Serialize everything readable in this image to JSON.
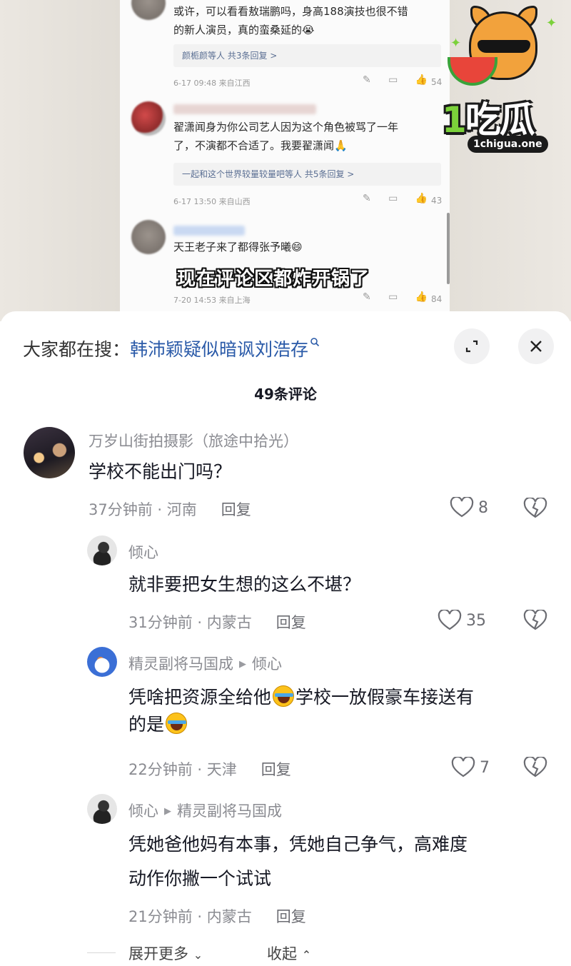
{
  "video": {
    "inner_comments": [
      {
        "text_l1": "或许，可以看看敖瑞鹏吗，身高188演技也很不错",
        "text_l2": "的新人演员，真的蛮桑延的😭",
        "replies": "颜栀颜等人  共3条回复 >",
        "meta": "6-17 09:48  来自江西",
        "likes": "54"
      },
      {
        "text_l1": "翟潇闻身为你公司艺人因为这个角色被骂了一年",
        "text_l2": "了，不演都不合适了。我要翟潇闻🙏",
        "replies": "一起和这个世界较量较量吧等人  共5条回复 >",
        "meta": "6-17 13:50  来自山西",
        "likes": "43"
      },
      {
        "text_l1": "天王老子来了都得张予曦😄",
        "meta": "7-20 14:53  来自上海",
        "likes": "84"
      }
    ],
    "caption": "现在评论区都炸开锅了"
  },
  "watermark": {
    "logo_text_num": "1",
    "logo_text": "吃瓜",
    "logo_url": "1chigua.one"
  },
  "sheet": {
    "search_prefix": "大家都在搜：",
    "search_query": "韩沛颖疑似暗讽刘浩存",
    "comment_count": "49条评论",
    "expand_icon": "expand-icon",
    "close_icon": "close-icon"
  },
  "comments": [
    {
      "name": "万岁山街拍摄影（旅途中拾光）",
      "text": "学校不能出门吗？",
      "time": "37分钟前 · 河南",
      "reply": "回复",
      "likes": "8"
    },
    {
      "name": "倾心",
      "text": "就非要把女生想的这么不堪？",
      "time": "31分钟前 · 内蒙古",
      "reply": "回复",
      "likes": "35"
    },
    {
      "name": "精灵副将马国成",
      "reply_to": "倾心",
      "text_a": "凭啥把资源全给他",
      "text_b": "学校一放假豪车接送有",
      "text_c": "的是",
      "time": "22分钟前 · 天津",
      "reply": "回复",
      "likes": "7"
    },
    {
      "name": "倾心",
      "reply_to": "精灵副将马国成",
      "text_l1": "凭她爸他妈有本事，凭她自己争气，高难度",
      "text_l2": "动作你撇一个试试",
      "time": "21分钟前 · 内蒙古",
      "reply": "回复"
    }
  ],
  "footer": {
    "expand_more": "展开更多",
    "collapse": "收起"
  },
  "colors": {
    "accent_blue": "#2a5aa8",
    "text_primary": "#161823",
    "text_secondary": "#8a8b91"
  }
}
